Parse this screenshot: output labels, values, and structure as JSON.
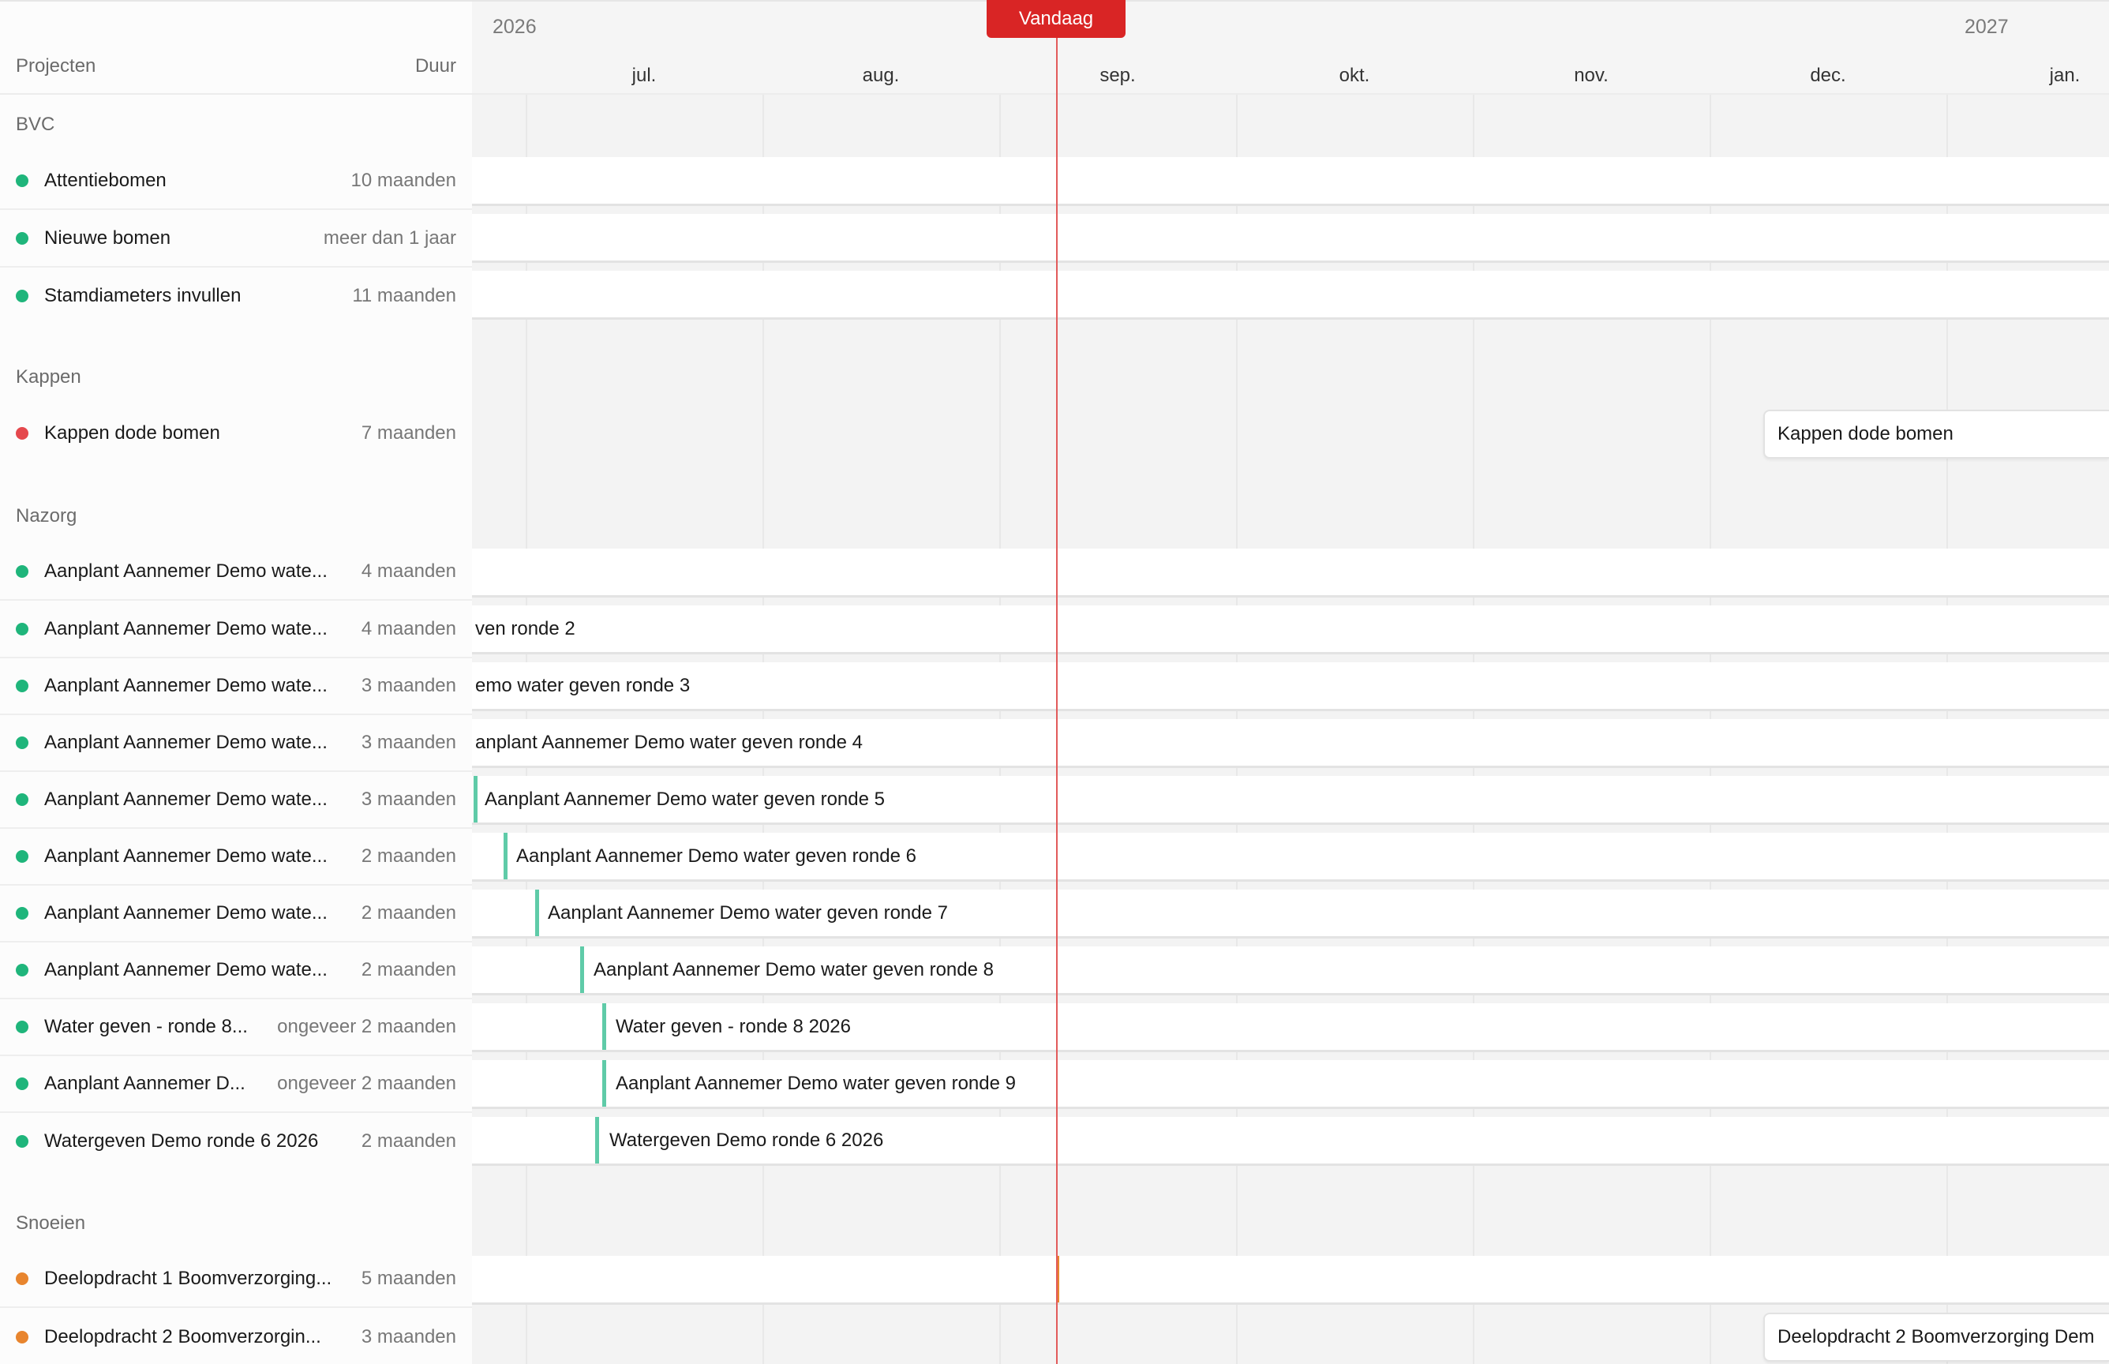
{
  "header": {
    "projects_label": "Projecten",
    "duration_label": "Duur"
  },
  "timeline": {
    "years": [
      "2026",
      "2027"
    ],
    "months": [
      "jul.",
      "aug.",
      "sep.",
      "okt.",
      "nov.",
      "dec.",
      "jan."
    ],
    "today_label": "Vandaag"
  },
  "colors": {
    "green": "#1fb57b",
    "red": "#e5484d",
    "orange": "#e8852e",
    "accent_bar": "#5fcba8",
    "today": "#d92525"
  },
  "groups": [
    {
      "name": "BVC",
      "projects": [
        {
          "name": "Attentiebomen",
          "duration": "10 maanden",
          "status": "green"
        },
        {
          "name": "Nieuwe bomen",
          "duration": "meer dan 1 jaar",
          "status": "green"
        },
        {
          "name": "Stamdiameters invullen",
          "duration": "11 maanden",
          "status": "green"
        }
      ]
    },
    {
      "name": "Kappen",
      "projects": [
        {
          "name": "Kappen dode bomen",
          "duration": "7 maanden",
          "status": "red"
        }
      ]
    },
    {
      "name": "Nazorg",
      "projects": [
        {
          "name": "Aanplant Aannemer Demo wate...",
          "duration": "4 maanden",
          "status": "green"
        },
        {
          "name": "Aanplant Aannemer Demo wate...",
          "duration": "4 maanden",
          "status": "green"
        },
        {
          "name": "Aanplant Aannemer Demo wate...",
          "duration": "3 maanden",
          "status": "green"
        },
        {
          "name": "Aanplant Aannemer Demo wate...",
          "duration": "3 maanden",
          "status": "green"
        },
        {
          "name": "Aanplant Aannemer Demo wate...",
          "duration": "3 maanden",
          "status": "green"
        },
        {
          "name": "Aanplant Aannemer Demo wate...",
          "duration": "2 maanden",
          "status": "green"
        },
        {
          "name": "Aanplant Aannemer Demo wate...",
          "duration": "2 maanden",
          "status": "green"
        },
        {
          "name": "Aanplant Aannemer Demo wate...",
          "duration": "2 maanden",
          "status": "green"
        },
        {
          "name": "Water geven - ronde 8...",
          "duration": "ongeveer 2 maanden",
          "status": "green"
        },
        {
          "name": "Aanplant Aannemer D...",
          "duration": "ongeveer 2 maanden",
          "status": "green"
        },
        {
          "name": "Watergeven Demo ronde 6 2026",
          "duration": "2 maanden",
          "status": "green"
        }
      ]
    },
    {
      "name": "Snoeien",
      "projects": [
        {
          "name": "Deelopdracht 1 Boomverzorging...",
          "duration": "5 maanden",
          "status": "orange"
        },
        {
          "name": "Deelopdracht 2 Boomverzorgin...",
          "duration": "3 maanden",
          "status": "orange"
        }
      ]
    }
  ],
  "bars": {
    "kappen": "Kappen dode bomen",
    "n2": "ven ronde 2",
    "n3": "emo water geven ronde 3",
    "n4": "anplant Aannemer Demo water geven ronde 4",
    "n5": "Aanplant Aannemer Demo water geven ronde 5",
    "n6": "Aanplant Aannemer Demo water geven ronde 6",
    "n7": "Aanplant Aannemer Demo water geven ronde 7",
    "n8": "Aanplant Aannemer Demo water geven ronde 8",
    "n9": "Water geven - ronde 8 2026",
    "n10": "Aanplant Aannemer Demo water geven ronde 9",
    "n11": "Watergeven Demo ronde 6 2026",
    "snoei2": "Deelopdracht 2 Boomverzorging Dem"
  }
}
